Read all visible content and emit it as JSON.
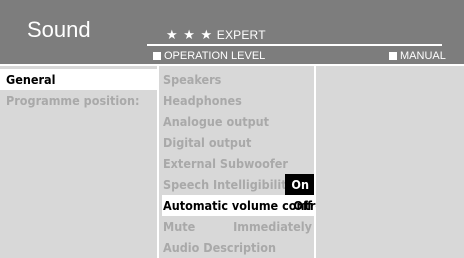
{
  "header": {
    "title": "Sound",
    "level_stars": "★ ★ ★",
    "level_name": "EXPERT",
    "operation_level_label": "OPERATION LEVEL",
    "manual_label": "MANUAL"
  },
  "left_menu": {
    "items": [
      {
        "label": "General",
        "selected": true
      },
      {
        "label": "Programme position:",
        "selected": false
      }
    ]
  },
  "sound_menu": {
    "items": [
      {
        "label": "Speakers",
        "value": ""
      },
      {
        "label": "Headphones",
        "value": ""
      },
      {
        "label": "Analogue output",
        "value": ""
      },
      {
        "label": "Digital output",
        "value": ""
      },
      {
        "label": "External Subwoofer",
        "value": ""
      },
      {
        "label": "Speech Intelligibility",
        "value": "On"
      },
      {
        "label": "Automatic volume control",
        "value": "Off"
      },
      {
        "label": "Mute",
        "value": "Immediately"
      },
      {
        "label": "Audio Description",
        "value": ""
      }
    ]
  },
  "colors": {
    "header_bg": "#7d7d7d",
    "panel_bg": "#d8d8d8",
    "disabled_text": "#a9a9a9",
    "selected_bg": "#ffffff"
  }
}
